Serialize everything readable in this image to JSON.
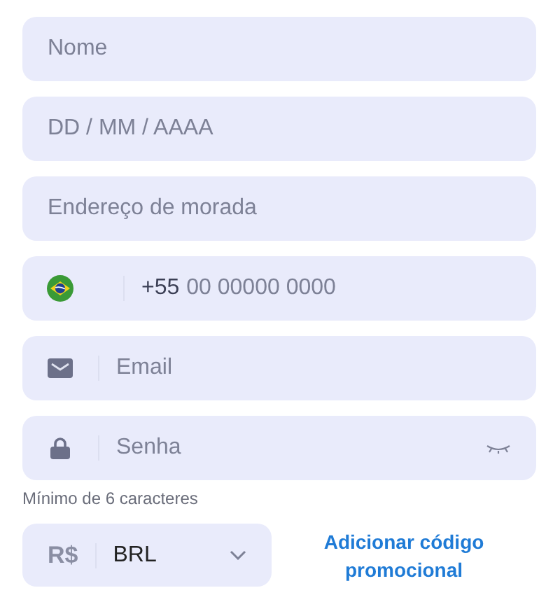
{
  "fields": [
    {
      "kind": "text",
      "placeholder": "Nome"
    },
    {
      "kind": "text",
      "placeholder": "DD / MM / AAAA"
    },
    {
      "kind": "text",
      "placeholder": "Endereço de morada"
    },
    {
      "kind": "phone",
      "prefix": "+55",
      "placeholder": "00 00000 0000"
    },
    {
      "kind": "email",
      "placeholder": "Email"
    },
    {
      "kind": "password",
      "placeholder": "Senha"
    }
  ],
  "password_hint": "Mínimo de 6 caracteres",
  "currency": {
    "symbol": "R$",
    "value": "BRL"
  },
  "promo_link": "Adicionar código promocional"
}
